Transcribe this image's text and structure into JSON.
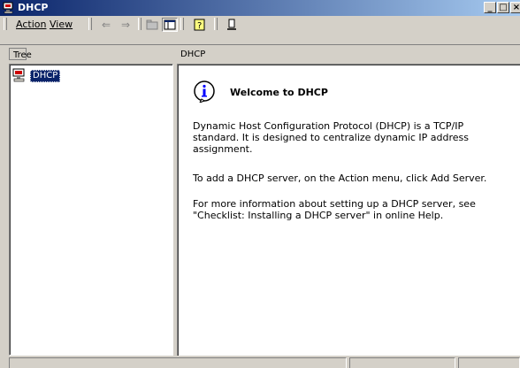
{
  "window": {
    "title": "DHCP",
    "icon": "dhcp-server-icon"
  },
  "window_controls": {
    "minimize": "_",
    "maximize": "□",
    "close": "×"
  },
  "menu": {
    "action": "Action",
    "view": "View"
  },
  "toolbar": {
    "icons": [
      "back-arrow-icon",
      "forward-arrow-icon",
      "up-folder-icon",
      "show-hide-tree-icon",
      "help-icon",
      "export-icon"
    ],
    "back": "⇐",
    "forward": "⇒"
  },
  "tabs": {
    "tree": "Tree",
    "details": "DHCP"
  },
  "tree": {
    "items": [
      {
        "label": "DHCP",
        "selected": true
      }
    ]
  },
  "content": {
    "heading": "Welcome to DHCP",
    "paragraphs": [
      "Dynamic Host Configuration Protocol (DHCP) is a TCP/IP standard. It is designed to centralize dynamic IP address assignment.",
      "To add a DHCP server, on the Action menu, click Add Server.",
      "For more information about setting up a DHCP server, see \"Checklist: Installing a DHCP server\" in online Help."
    ]
  },
  "colors": {
    "titlebar_start": "#0a246a",
    "titlebar_end": "#a6caf0",
    "face": "#d4d0c8",
    "selection": "#0a246a"
  }
}
